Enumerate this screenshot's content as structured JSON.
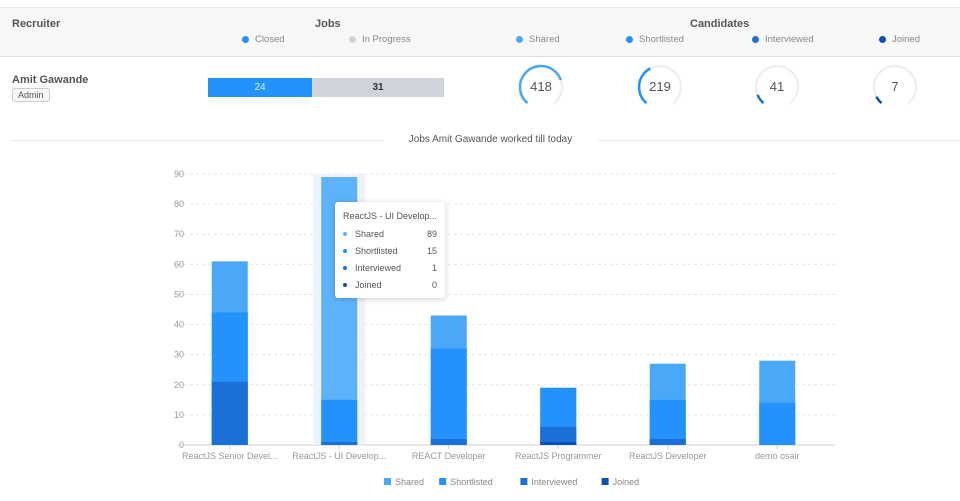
{
  "header": {
    "recruiter": "Recruiter",
    "jobs": "Jobs",
    "candidates": "Candidates",
    "jobs_legend": [
      {
        "label": "Closed",
        "color": "#2492fc"
      },
      {
        "label": "In Progress",
        "color": "#d0d4da"
      }
    ],
    "candidates_legend": [
      {
        "label": "Shared",
        "color": "#4aa8f8"
      },
      {
        "label": "Shortlisted",
        "color": "#2492fc"
      },
      {
        "label": "Interviewed",
        "color": "#1a70d6"
      },
      {
        "label": "Joined",
        "color": "#0b52b8"
      }
    ]
  },
  "recruiter": {
    "name": "Amit Gawande",
    "role": "Admin",
    "jobs_closed": "24",
    "jobs_in_progress": "31",
    "candidates": [
      {
        "label": "Shared",
        "value": "418",
        "fraction": 0.75,
        "color": "#4aa8f8"
      },
      {
        "label": "Shortlisted",
        "value": "219",
        "fraction": 0.4,
        "color": "#2492fc"
      },
      {
        "label": "Interviewed",
        "value": "41",
        "fraction": 0.1,
        "color": "#1a70d6"
      },
      {
        "label": "Joined",
        "value": "7",
        "fraction": 0.08,
        "color": "#0b52b8"
      }
    ]
  },
  "section_title": "Jobs Amit Gawande worked till today",
  "tooltip": {
    "title": "ReactJS - UI Develop...",
    "rows": [
      {
        "label": "Shared",
        "value": "89",
        "color": "#5eb2fa"
      },
      {
        "label": "Shortlisted",
        "value": "15",
        "color": "#2492fc"
      },
      {
        "label": "Interviewed",
        "value": "1",
        "color": "#1a70d6"
      },
      {
        "label": "Joined",
        "value": "0",
        "color": "#0b52b8"
      }
    ]
  },
  "chart_data": {
    "type": "bar",
    "ylim": [
      0,
      90
    ],
    "yticks": [
      0,
      10,
      20,
      30,
      40,
      50,
      60,
      70,
      80,
      90
    ],
    "grid": true,
    "legend": "bottom",
    "highlighted": "ReactJS - UI Develop...",
    "categories": [
      "ReactJS Senior Devel...",
      "ReactJS - UI Develop...",
      "REACT Developer",
      "ReactJS Programmer",
      "ReactJS Developer",
      "demo osair"
    ],
    "series": [
      {
        "name": "Shared",
        "color": "#4aa8f8",
        "values": [
          61,
          89,
          43,
          19,
          27,
          28
        ]
      },
      {
        "name": "Shortlisted",
        "color": "#2492fc",
        "values": [
          44,
          15,
          32,
          19,
          15,
          14
        ]
      },
      {
        "name": "Interviewed",
        "color": "#1a70d6",
        "values": [
          21,
          1,
          2,
          6,
          2,
          0
        ]
      },
      {
        "name": "Joined",
        "color": "#0b52b8",
        "values": [
          0,
          0,
          0,
          1,
          0,
          0
        ]
      }
    ]
  }
}
